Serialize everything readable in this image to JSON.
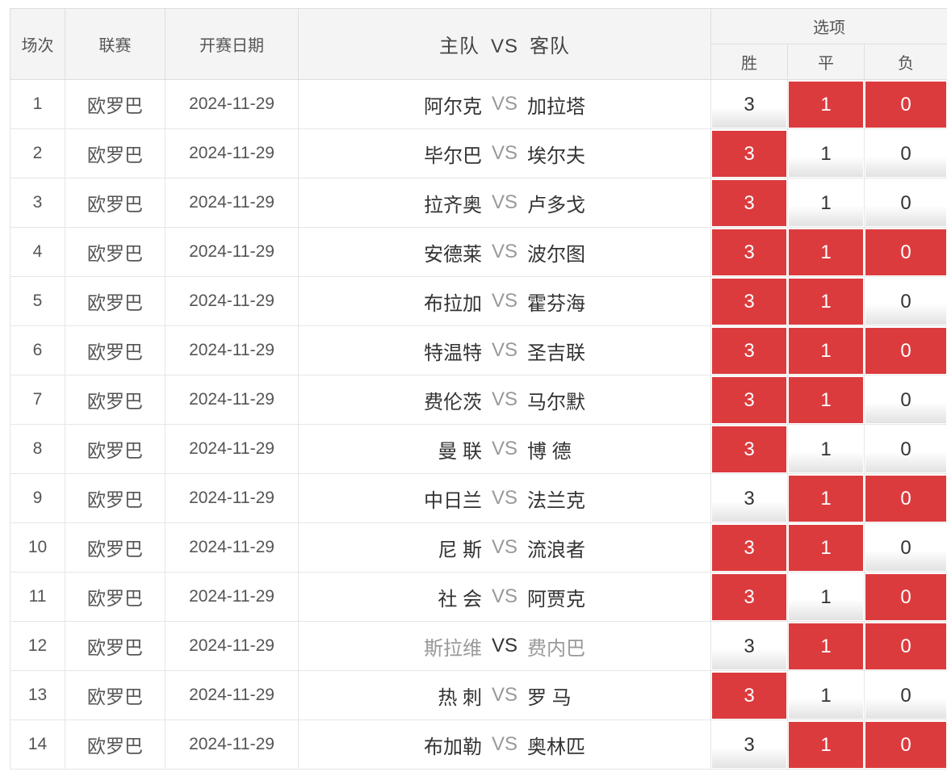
{
  "header": {
    "col_num": "场次",
    "col_league": "联赛",
    "col_date": "开赛日期",
    "col_home": "主队",
    "col_vs": "VS",
    "col_away": "客队",
    "col_options": "选项",
    "opt_win": "胜",
    "opt_draw": "平",
    "opt_loss": "负"
  },
  "colors": {
    "selected": "#dc3b3e",
    "header_bg": "#f4f4f4"
  },
  "rows": [
    {
      "num": "1",
      "league": "欧罗巴",
      "date": "2024-11-29",
      "home": "阿尔克",
      "vs": "VS",
      "away": "加拉塔",
      "win": "3",
      "draw": "1",
      "loss": "0",
      "win_sel": false,
      "draw_sel": true,
      "loss_sel": true,
      "dim": false
    },
    {
      "num": "2",
      "league": "欧罗巴",
      "date": "2024-11-29",
      "home": "毕尔巴",
      "vs": "VS",
      "away": "埃尔夫",
      "win": "3",
      "draw": "1",
      "loss": "0",
      "win_sel": true,
      "draw_sel": false,
      "loss_sel": false,
      "dim": false
    },
    {
      "num": "3",
      "league": "欧罗巴",
      "date": "2024-11-29",
      "home": "拉齐奥",
      "vs": "VS",
      "away": "卢多戈",
      "win": "3",
      "draw": "1",
      "loss": "0",
      "win_sel": true,
      "draw_sel": false,
      "loss_sel": false,
      "dim": false
    },
    {
      "num": "4",
      "league": "欧罗巴",
      "date": "2024-11-29",
      "home": "安德莱",
      "vs": "VS",
      "away": "波尔图",
      "win": "3",
      "draw": "1",
      "loss": "0",
      "win_sel": true,
      "draw_sel": true,
      "loss_sel": true,
      "dim": false
    },
    {
      "num": "5",
      "league": "欧罗巴",
      "date": "2024-11-29",
      "home": "布拉加",
      "vs": "VS",
      "away": "霍芬海",
      "win": "3",
      "draw": "1",
      "loss": "0",
      "win_sel": true,
      "draw_sel": true,
      "loss_sel": false,
      "dim": false
    },
    {
      "num": "6",
      "league": "欧罗巴",
      "date": "2024-11-29",
      "home": "特温特",
      "vs": "VS",
      "away": "圣吉联",
      "win": "3",
      "draw": "1",
      "loss": "0",
      "win_sel": true,
      "draw_sel": true,
      "loss_sel": true,
      "dim": false
    },
    {
      "num": "7",
      "league": "欧罗巴",
      "date": "2024-11-29",
      "home": "费伦茨",
      "vs": "VS",
      "away": "马尔默",
      "win": "3",
      "draw": "1",
      "loss": "0",
      "win_sel": true,
      "draw_sel": true,
      "loss_sel": false,
      "dim": false
    },
    {
      "num": "8",
      "league": "欧罗巴",
      "date": "2024-11-29",
      "home": "曼 联",
      "vs": "VS",
      "away": "博 德",
      "win": "3",
      "draw": "1",
      "loss": "0",
      "win_sel": true,
      "draw_sel": false,
      "loss_sel": false,
      "dim": false
    },
    {
      "num": "9",
      "league": "欧罗巴",
      "date": "2024-11-29",
      "home": "中日兰",
      "vs": "VS",
      "away": "法兰克",
      "win": "3",
      "draw": "1",
      "loss": "0",
      "win_sel": false,
      "draw_sel": true,
      "loss_sel": true,
      "dim": false
    },
    {
      "num": "10",
      "league": "欧罗巴",
      "date": "2024-11-29",
      "home": "尼 斯",
      "vs": "VS",
      "away": "流浪者",
      "win": "3",
      "draw": "1",
      "loss": "0",
      "win_sel": true,
      "draw_sel": true,
      "loss_sel": false,
      "dim": false
    },
    {
      "num": "11",
      "league": "欧罗巴",
      "date": "2024-11-29",
      "home": "社 会",
      "vs": "VS",
      "away": "阿贾克",
      "win": "3",
      "draw": "1",
      "loss": "0",
      "win_sel": true,
      "draw_sel": false,
      "loss_sel": true,
      "dim": false
    },
    {
      "num": "12",
      "league": "欧罗巴",
      "date": "2024-11-29",
      "home": "斯拉维",
      "vs": "VS",
      "away": "费内巴",
      "win": "3",
      "draw": "1",
      "loss": "0",
      "win_sel": false,
      "draw_sel": true,
      "loss_sel": true,
      "dim": true
    },
    {
      "num": "13",
      "league": "欧罗巴",
      "date": "2024-11-29",
      "home": "热 刺",
      "vs": "VS",
      "away": "罗 马",
      "win": "3",
      "draw": "1",
      "loss": "0",
      "win_sel": true,
      "draw_sel": false,
      "loss_sel": false,
      "dim": false
    },
    {
      "num": "14",
      "league": "欧罗巴",
      "date": "2024-11-29",
      "home": "布加勒",
      "vs": "VS",
      "away": "奥林匹",
      "win": "3",
      "draw": "1",
      "loss": "0",
      "win_sel": false,
      "draw_sel": true,
      "loss_sel": true,
      "dim": false
    }
  ]
}
